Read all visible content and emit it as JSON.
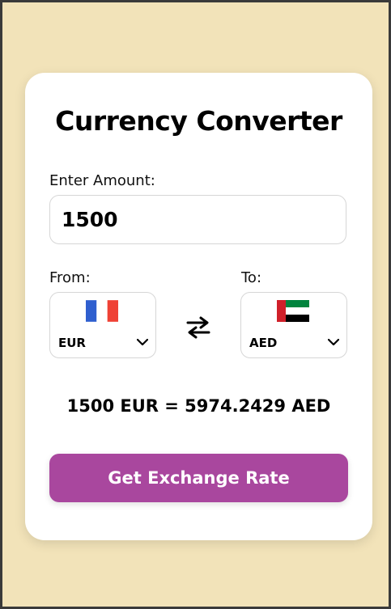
{
  "title": "Currency Converter",
  "amount": {
    "label": "Enter Amount:",
    "value": "1500"
  },
  "from": {
    "label": "From:",
    "code": "EUR",
    "flag": "france-flag-icon",
    "options_selected": "EUR"
  },
  "to": {
    "label": "To:",
    "code": "AED",
    "flag": "uae-flag-icon",
    "options_selected": "AED"
  },
  "swap_icon": "swap-arrows-icon",
  "result": "1500 EUR = 5974.2429 AED",
  "button_label": "Get Exchange Rate",
  "colors": {
    "background": "#f2e3b9",
    "card": "#ffffff",
    "button": "#a9479e",
    "button_text": "#ffffff"
  }
}
